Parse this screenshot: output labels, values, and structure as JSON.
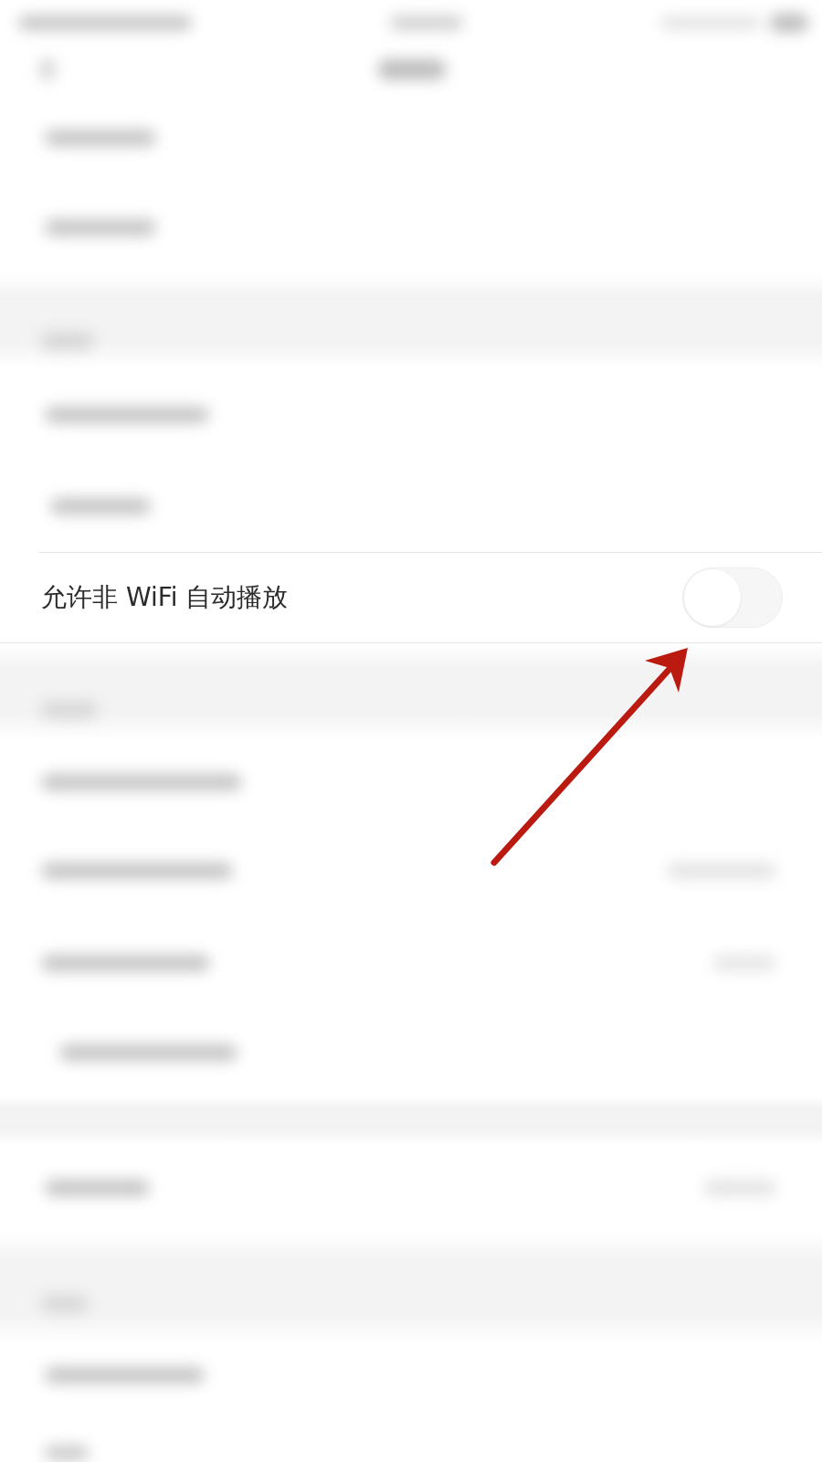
{
  "setting": {
    "label": "允许非 WiFi 自动播放",
    "on": false
  }
}
